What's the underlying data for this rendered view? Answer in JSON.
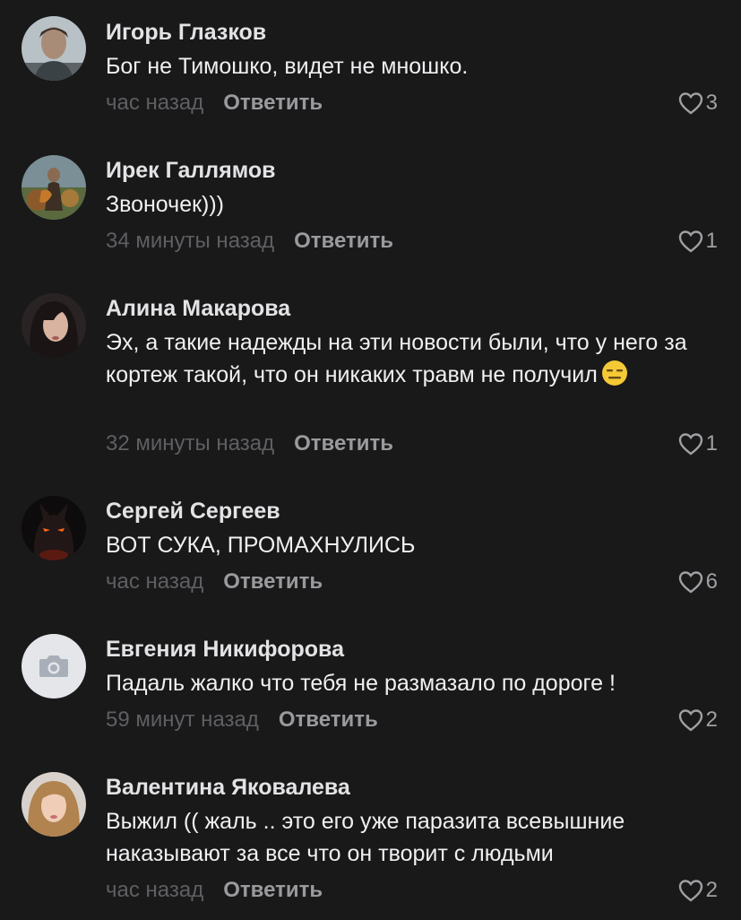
{
  "reply_label": "Ответить",
  "comments": [
    {
      "author": "Игорь Глазков",
      "text": "Бог не Тимошко, видет не мношко.",
      "time": "час назад",
      "likes": "3",
      "avatar": "photo-man-portrait"
    },
    {
      "author": "Ирек Галлямов",
      "text": "Звоночек)))",
      "time": "34 минуты назад",
      "likes": "1",
      "avatar": "photo-outdoor"
    },
    {
      "author": "Алина Макарова",
      "text": "Эх, а такие надежды на эти новости были, что у него за кортеж такой, что он никаких травм не получил",
      "emoji": "expressionless-face-emoji",
      "time": "32 минуты назад",
      "likes": "1",
      "avatar": "photo-woman-dark-hair"
    },
    {
      "author": "Сергей Сергеев",
      "text": "ВОТ СУКА, ПРОМАХНУЛИСЬ",
      "time": "час назад",
      "likes": "6",
      "avatar": "dark-demon-image"
    },
    {
      "author": "Евгения Никифорова",
      "text": "Падаль жалко что тебя не размазало по дороге !",
      "time": "59 минут назад",
      "likes": "2",
      "avatar": "camera-placeholder-icon"
    },
    {
      "author": "Валентина Яковалева",
      "text": "Выжил (( жаль .. это его уже паразита всевышние наказывают за все что он творит с людьми",
      "time": "час назад",
      "likes": "2",
      "avatar": "photo-woman-blonde"
    }
  ],
  "colors": {
    "background": "#19191a",
    "author": "#e3e3e5",
    "text": "#f0f0f2",
    "time": "#5f5f63",
    "reply": "#9a9a9e"
  }
}
